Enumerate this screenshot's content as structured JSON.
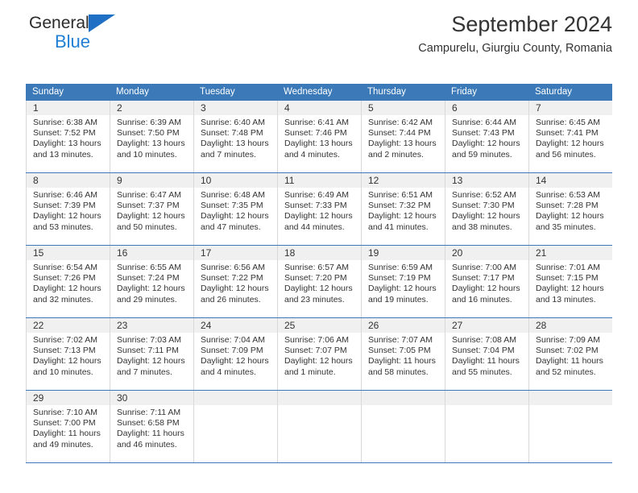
{
  "brand": {
    "name_top": "General",
    "name_bottom": "Blue",
    "accent_color": "#1f7fd4",
    "triangle_color": "#1f6fc4"
  },
  "header": {
    "title": "September 2024",
    "subtitle": "Campurelu, Giurgiu County, Romania"
  },
  "theme": {
    "header_blue": "#3b79b8",
    "daynum_band": "#f0f0f0",
    "text": "#333333",
    "cell_border": "#d8d8d8"
  },
  "weekdays": [
    "Sunday",
    "Monday",
    "Tuesday",
    "Wednesday",
    "Thursday",
    "Friday",
    "Saturday"
  ],
  "weeks": [
    [
      {
        "day": "1",
        "sunrise": "Sunrise: 6:38 AM",
        "sunset": "Sunset: 7:52 PM",
        "daylight1": "Daylight: 13 hours",
        "daylight2": "and 13 minutes."
      },
      {
        "day": "2",
        "sunrise": "Sunrise: 6:39 AM",
        "sunset": "Sunset: 7:50 PM",
        "daylight1": "Daylight: 13 hours",
        "daylight2": "and 10 minutes."
      },
      {
        "day": "3",
        "sunrise": "Sunrise: 6:40 AM",
        "sunset": "Sunset: 7:48 PM",
        "daylight1": "Daylight: 13 hours",
        "daylight2": "and 7 minutes."
      },
      {
        "day": "4",
        "sunrise": "Sunrise: 6:41 AM",
        "sunset": "Sunset: 7:46 PM",
        "daylight1": "Daylight: 13 hours",
        "daylight2": "and 4 minutes."
      },
      {
        "day": "5",
        "sunrise": "Sunrise: 6:42 AM",
        "sunset": "Sunset: 7:44 PM",
        "daylight1": "Daylight: 13 hours",
        "daylight2": "and 2 minutes."
      },
      {
        "day": "6",
        "sunrise": "Sunrise: 6:44 AM",
        "sunset": "Sunset: 7:43 PM",
        "daylight1": "Daylight: 12 hours",
        "daylight2": "and 59 minutes."
      },
      {
        "day": "7",
        "sunrise": "Sunrise: 6:45 AM",
        "sunset": "Sunset: 7:41 PM",
        "daylight1": "Daylight: 12 hours",
        "daylight2": "and 56 minutes."
      }
    ],
    [
      {
        "day": "8",
        "sunrise": "Sunrise: 6:46 AM",
        "sunset": "Sunset: 7:39 PM",
        "daylight1": "Daylight: 12 hours",
        "daylight2": "and 53 minutes."
      },
      {
        "day": "9",
        "sunrise": "Sunrise: 6:47 AM",
        "sunset": "Sunset: 7:37 PM",
        "daylight1": "Daylight: 12 hours",
        "daylight2": "and 50 minutes."
      },
      {
        "day": "10",
        "sunrise": "Sunrise: 6:48 AM",
        "sunset": "Sunset: 7:35 PM",
        "daylight1": "Daylight: 12 hours",
        "daylight2": "and 47 minutes."
      },
      {
        "day": "11",
        "sunrise": "Sunrise: 6:49 AM",
        "sunset": "Sunset: 7:33 PM",
        "daylight1": "Daylight: 12 hours",
        "daylight2": "and 44 minutes."
      },
      {
        "day": "12",
        "sunrise": "Sunrise: 6:51 AM",
        "sunset": "Sunset: 7:32 PM",
        "daylight1": "Daylight: 12 hours",
        "daylight2": "and 41 minutes."
      },
      {
        "day": "13",
        "sunrise": "Sunrise: 6:52 AM",
        "sunset": "Sunset: 7:30 PM",
        "daylight1": "Daylight: 12 hours",
        "daylight2": "and 38 minutes."
      },
      {
        "day": "14",
        "sunrise": "Sunrise: 6:53 AM",
        "sunset": "Sunset: 7:28 PM",
        "daylight1": "Daylight: 12 hours",
        "daylight2": "and 35 minutes."
      }
    ],
    [
      {
        "day": "15",
        "sunrise": "Sunrise: 6:54 AM",
        "sunset": "Sunset: 7:26 PM",
        "daylight1": "Daylight: 12 hours",
        "daylight2": "and 32 minutes."
      },
      {
        "day": "16",
        "sunrise": "Sunrise: 6:55 AM",
        "sunset": "Sunset: 7:24 PM",
        "daylight1": "Daylight: 12 hours",
        "daylight2": "and 29 minutes."
      },
      {
        "day": "17",
        "sunrise": "Sunrise: 6:56 AM",
        "sunset": "Sunset: 7:22 PM",
        "daylight1": "Daylight: 12 hours",
        "daylight2": "and 26 minutes."
      },
      {
        "day": "18",
        "sunrise": "Sunrise: 6:57 AM",
        "sunset": "Sunset: 7:20 PM",
        "daylight1": "Daylight: 12 hours",
        "daylight2": "and 23 minutes."
      },
      {
        "day": "19",
        "sunrise": "Sunrise: 6:59 AM",
        "sunset": "Sunset: 7:19 PM",
        "daylight1": "Daylight: 12 hours",
        "daylight2": "and 19 minutes."
      },
      {
        "day": "20",
        "sunrise": "Sunrise: 7:00 AM",
        "sunset": "Sunset: 7:17 PM",
        "daylight1": "Daylight: 12 hours",
        "daylight2": "and 16 minutes."
      },
      {
        "day": "21",
        "sunrise": "Sunrise: 7:01 AM",
        "sunset": "Sunset: 7:15 PM",
        "daylight1": "Daylight: 12 hours",
        "daylight2": "and 13 minutes."
      }
    ],
    [
      {
        "day": "22",
        "sunrise": "Sunrise: 7:02 AM",
        "sunset": "Sunset: 7:13 PM",
        "daylight1": "Daylight: 12 hours",
        "daylight2": "and 10 minutes."
      },
      {
        "day": "23",
        "sunrise": "Sunrise: 7:03 AM",
        "sunset": "Sunset: 7:11 PM",
        "daylight1": "Daylight: 12 hours",
        "daylight2": "and 7 minutes."
      },
      {
        "day": "24",
        "sunrise": "Sunrise: 7:04 AM",
        "sunset": "Sunset: 7:09 PM",
        "daylight1": "Daylight: 12 hours",
        "daylight2": "and 4 minutes."
      },
      {
        "day": "25",
        "sunrise": "Sunrise: 7:06 AM",
        "sunset": "Sunset: 7:07 PM",
        "daylight1": "Daylight: 12 hours",
        "daylight2": "and 1 minute."
      },
      {
        "day": "26",
        "sunrise": "Sunrise: 7:07 AM",
        "sunset": "Sunset: 7:05 PM",
        "daylight1": "Daylight: 11 hours",
        "daylight2": "and 58 minutes."
      },
      {
        "day": "27",
        "sunrise": "Sunrise: 7:08 AM",
        "sunset": "Sunset: 7:04 PM",
        "daylight1": "Daylight: 11 hours",
        "daylight2": "and 55 minutes."
      },
      {
        "day": "28",
        "sunrise": "Sunrise: 7:09 AM",
        "sunset": "Sunset: 7:02 PM",
        "daylight1": "Daylight: 11 hours",
        "daylight2": "and 52 minutes."
      }
    ],
    [
      {
        "day": "29",
        "sunrise": "Sunrise: 7:10 AM",
        "sunset": "Sunset: 7:00 PM",
        "daylight1": "Daylight: 11 hours",
        "daylight2": "and 49 minutes."
      },
      {
        "day": "30",
        "sunrise": "Sunrise: 7:11 AM",
        "sunset": "Sunset: 6:58 PM",
        "daylight1": "Daylight: 11 hours",
        "daylight2": "and 46 minutes."
      },
      {
        "day": "",
        "sunrise": "",
        "sunset": "",
        "daylight1": "",
        "daylight2": ""
      },
      {
        "day": "",
        "sunrise": "",
        "sunset": "",
        "daylight1": "",
        "daylight2": ""
      },
      {
        "day": "",
        "sunrise": "",
        "sunset": "",
        "daylight1": "",
        "daylight2": ""
      },
      {
        "day": "",
        "sunrise": "",
        "sunset": "",
        "daylight1": "",
        "daylight2": ""
      },
      {
        "day": "",
        "sunrise": "",
        "sunset": "",
        "daylight1": "",
        "daylight2": ""
      }
    ]
  ]
}
